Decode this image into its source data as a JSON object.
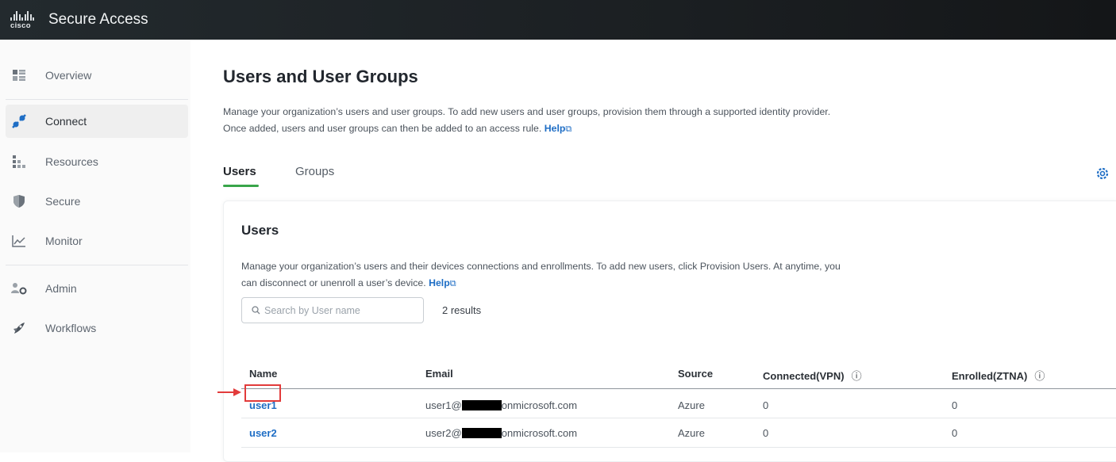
{
  "app": {
    "brand": "cisco",
    "title": "Secure Access"
  },
  "sidebar": {
    "items": [
      {
        "label": "Overview",
        "icon": "overview-icon"
      },
      {
        "label": "Connect",
        "icon": "connect-icon",
        "active": true
      },
      {
        "label": "Resources",
        "icon": "resources-icon"
      },
      {
        "label": "Secure",
        "icon": "shield-icon"
      },
      {
        "label": "Monitor",
        "icon": "monitor-icon"
      },
      {
        "label": "Admin",
        "icon": "admin-icon"
      },
      {
        "label": "Workflows",
        "icon": "workflows-icon"
      }
    ]
  },
  "page": {
    "title": "Users and User Groups",
    "description_line1": "Manage your organization’s users and user groups. To add new users and user groups, provision them through a supported identity provider.",
    "description_line2": "Once added, users and user groups can then be added to an access rule.",
    "help_label": "Help",
    "tabs": [
      {
        "label": "Users",
        "active": true
      },
      {
        "label": "Groups"
      }
    ]
  },
  "users_card": {
    "title": "Users",
    "description_line1": "Manage your organization’s users and their devices connections and enrollments. To add new users, click Provision Users. At anytime, you",
    "description_line2": "can disconnect or unenroll a user’s device.",
    "help_label": "Help",
    "search_placeholder": "Search by User name",
    "results": "2 results",
    "columns": [
      "Name",
      "Email",
      "Source",
      "Connected(VPN)",
      "Enrolled(ZTNA)"
    ],
    "rows": [
      {
        "name": "user1",
        "email_prefix": "user1@",
        "email_suffix": "onmicrosoft.com",
        "source": "Azure",
        "connected": "0",
        "enrolled": "0"
      },
      {
        "name": "user2",
        "email_prefix": "user2@",
        "email_suffix": "onmicrosoft.com",
        "source": "Azure",
        "connected": "0",
        "enrolled": "0"
      }
    ]
  },
  "colors": {
    "accent_link": "#1f6ec5",
    "tab_underline": "#39a54a",
    "highlight": "#e23b3b",
    "topbar": "#1b1f22"
  }
}
